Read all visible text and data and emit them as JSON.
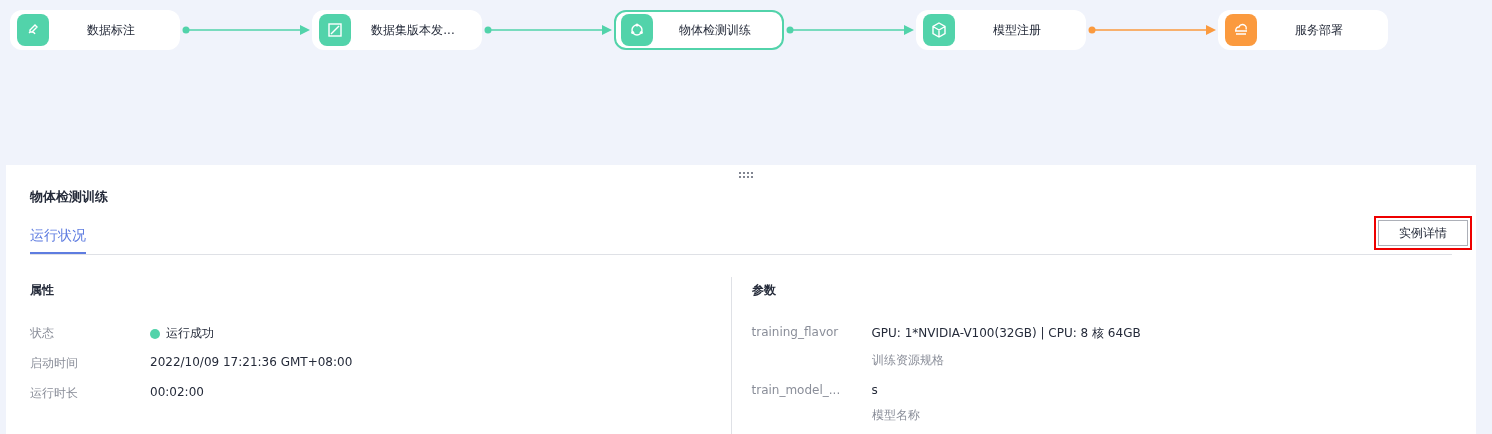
{
  "pipeline": {
    "nodes": [
      {
        "label": "数据标注",
        "kind": "pen",
        "color": "#52d3aa",
        "selected": false
      },
      {
        "label": "数据集版本发...",
        "kind": "frame",
        "color": "#52d3aa",
        "selected": false
      },
      {
        "label": "物体检测训练",
        "kind": "cycle",
        "color": "#52d3aa",
        "selected": true
      },
      {
        "label": "模型注册",
        "kind": "cube",
        "color": "#52d3aa",
        "selected": false
      },
      {
        "label": "服务部署",
        "kind": "cloud",
        "color": "#fb9a3e",
        "selected": false
      }
    ],
    "connectors": [
      {
        "color": "#52d3aa"
      },
      {
        "color": "#52d3aa"
      },
      {
        "color": "#52d3aa"
      },
      {
        "color": "#fb9a3e"
      }
    ]
  },
  "panel": {
    "title": "物体检测训练",
    "tabs": [
      {
        "label": "运行状况",
        "selected": true
      }
    ],
    "button": {
      "label": "实例详情",
      "highlighted": true
    },
    "properties": {
      "heading": "属性",
      "rows": [
        {
          "label": "状态",
          "value": "运行成功",
          "color": "#52d3aa"
        },
        {
          "label": "启动时间",
          "value": "2022/10/09 17:21:36 GMT+08:00"
        },
        {
          "label": "运行时长",
          "value": "00:02:00"
        }
      ]
    },
    "parameters": {
      "heading": "参数",
      "rows": [
        {
          "label": "training_flavor",
          "value": "GPU: 1*NVIDIA-V100(32GB) | CPU: 8 核 64GB",
          "description": "训练资源规格"
        },
        {
          "label": "train_model_...",
          "value": "s",
          "description": "模型名称"
        }
      ]
    }
  }
}
